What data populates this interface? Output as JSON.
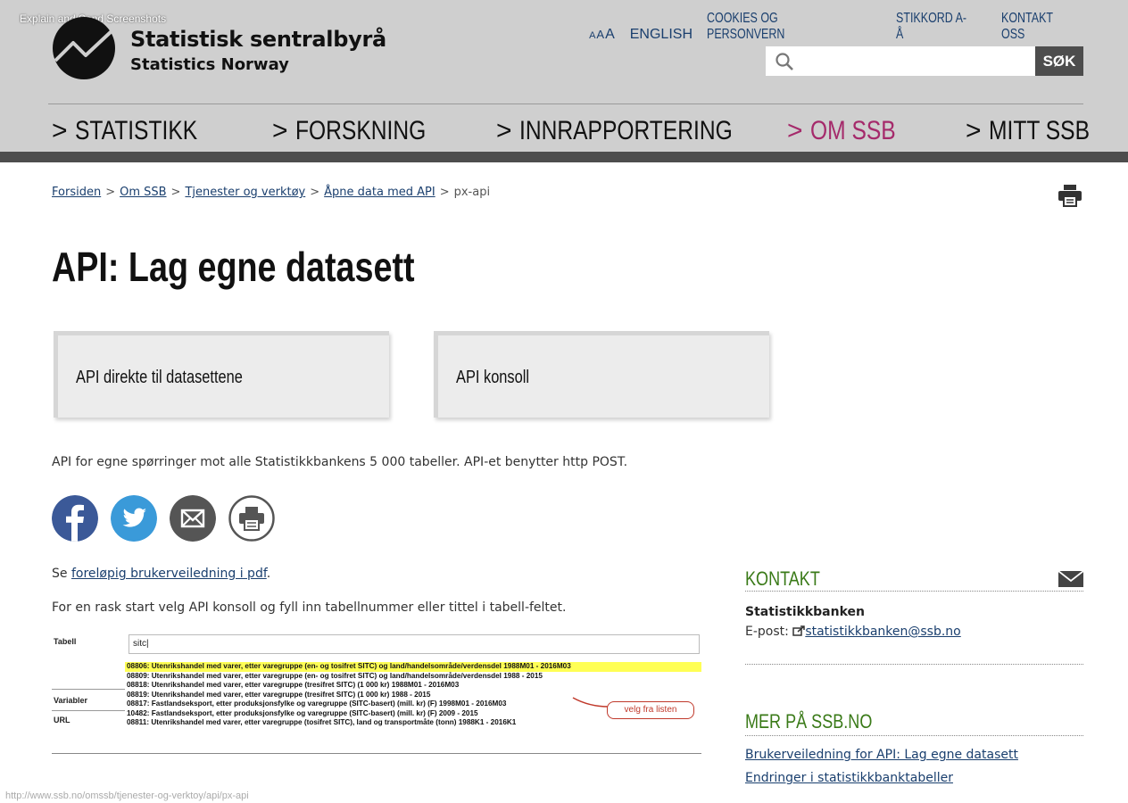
{
  "overlay": {
    "tool_label": "Explain and Send Screenshots"
  },
  "brand": {
    "name_no": "Statistisk sentralbyrå",
    "name_en": "Statistics Norway"
  },
  "top_links": {
    "font_small": "A",
    "font_medium": "A",
    "font_large": "A",
    "english": "ENGLISH",
    "cookies": "COOKIES OG PERSONVERN",
    "index": "STIKKORD A-Å",
    "contact": "KONTAKT OSS"
  },
  "search": {
    "placeholder": "",
    "button_label": "SØK",
    "icon": "search-icon"
  },
  "nav": [
    {
      "label": "STATISTIKK",
      "active": false
    },
    {
      "label": "FORSKNING",
      "active": false
    },
    {
      "label": "INNRAPPORTERING",
      "active": false
    },
    {
      "label": "OM SSB",
      "active": true
    },
    {
      "label": "MITT SSB",
      "active": false
    }
  ],
  "nav_arrow": ">",
  "breadcrumb": {
    "items": [
      "Forsiden",
      "Om SSB",
      "Tjenester og verktøy",
      "Åpne data med API"
    ],
    "current": "px-api",
    "separator": ">"
  },
  "page": {
    "title": "API: Lag egne datasett",
    "cards": [
      "API direkte til datasettene",
      "API konsoll"
    ],
    "intro": "API for egne spørringer mot alle Statistikkbankens 5 000 tabeller. API-et benytter http POST.",
    "guide_prefix": "Se ",
    "guide_link": "foreløpig brukerveiledning i pdf",
    "guide_suffix": ".",
    "quickstart": "For en rask start velg API konsoll og fyll inn tabellnummer eller tittel i tabell-feltet."
  },
  "embedded_screenshot": {
    "labels": {
      "tabell": "Tabell",
      "variabler": "Variabler",
      "url": "URL"
    },
    "input_value": "sitc|",
    "options": [
      "08806: Utenrikshandel med varer, etter varegruppe (en- og tosifret SITC) og land/handelsområde/verdensdel 1988M01 - 2016M03",
      "08809: Utenrikshandel med varer, etter varegruppe (en- og tosifret SITC) og land/handelsområde/verdensdel 1988 - 2015",
      "08818: Utenrikshandel med varer, etter varegruppe (tresifret SITC) (1 000 kr) 1988M01 - 2016M03",
      "08819: Utenrikshandel med varer, etter varegruppe (tresifret SITC) (1 000 kr) 1988 - 2015",
      "08817: Fastlandseksport, etter produksjonsfylke og varegruppe (SITC-basert) (mill. kr) (F) 1998M01 - 2016M03",
      "10482: Fastlandseksport, etter produksjonsfylke og varegruppe (SITC-basert) (mill. kr) (F) 2009 - 2015",
      "08811: Utenrikshandel med varer, etter varegruppe (tosifret SITC), land og transportmåte (tonn) 1988K1 - 2016K1"
    ],
    "highlighted_index": 0,
    "callout": "velg fra listen"
  },
  "sidebar": {
    "contact_heading": "KONTAKT",
    "contact_name": "Statistikkbanken",
    "email_prefix": "E-post: ",
    "email": "statistikkbanken@ssb.no",
    "more_heading": "MER PÅ SSB.NO",
    "links": [
      "Brukerveiledning for API: Lag egne datasett",
      "Endringer i statistikkbanktabeller"
    ]
  },
  "status_bar": {
    "url": "http://www.ssb.no/omssb/tjenester-og-verktoy/api/px-api"
  },
  "colors": {
    "header_bg": "#cfcfcf",
    "nav_active": "#a52a6b",
    "link": "#1a3f6e",
    "sidebar_heading": "#3a7a18",
    "facebook": "#3b5998",
    "twitter": "#3a9ad9",
    "mail": "#555555"
  }
}
